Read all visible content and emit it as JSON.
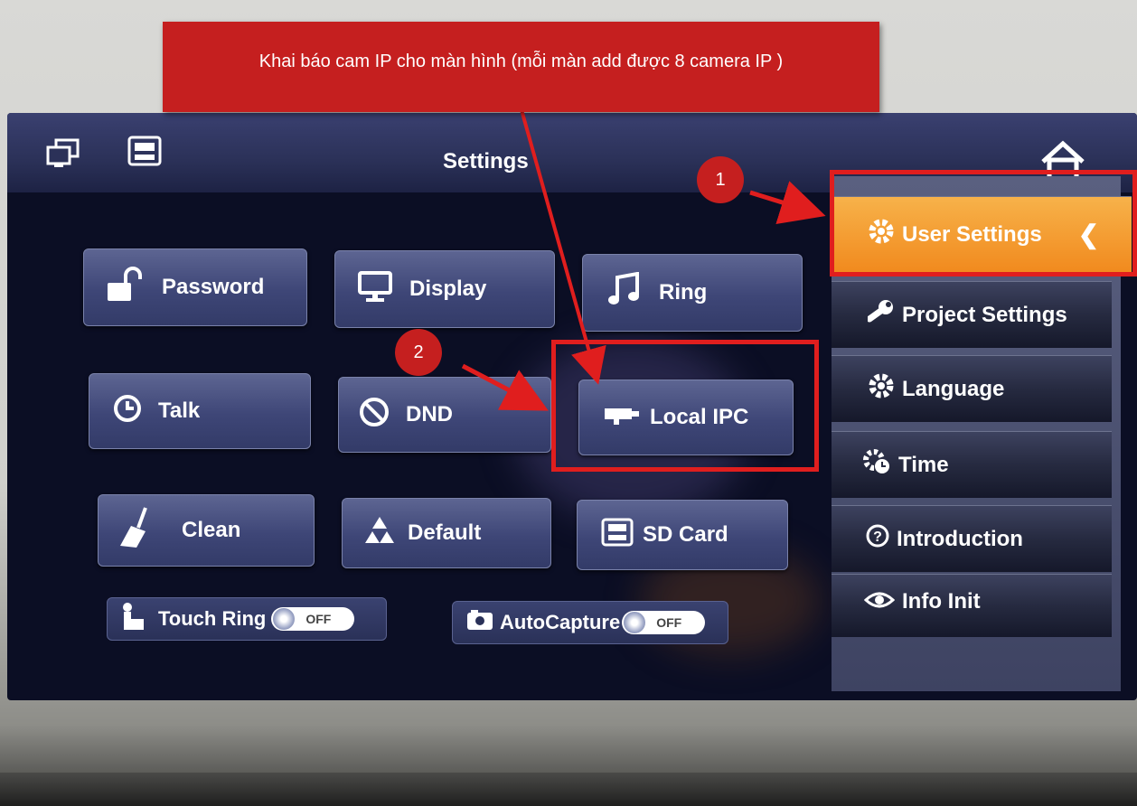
{
  "header": {
    "title": "Settings"
  },
  "buttons": {
    "password": "Password",
    "display": "Display",
    "ring": "Ring",
    "talk": "Talk",
    "dnd": "DND",
    "local_ipc": "Local IPC",
    "clean": "Clean",
    "default": "Default",
    "sd_card": "SD Card"
  },
  "toggles": {
    "touch_ring": {
      "label": "Touch Ring",
      "state": "OFF"
    },
    "auto_capture": {
      "label": "AutoCapture",
      "state": "OFF"
    }
  },
  "sidebar": {
    "items": [
      {
        "label": "User Settings",
        "icon": "gear-icon",
        "active": true
      },
      {
        "label": "Project Settings",
        "icon": "wrench-icon"
      },
      {
        "label": "Language",
        "icon": "gear-icon"
      },
      {
        "label": "Time",
        "icon": "gear-clock-icon"
      },
      {
        "label": "Introduction",
        "icon": "question-icon"
      },
      {
        "label": "Info Init",
        "icon": "eye-icon"
      }
    ]
  },
  "annotations": {
    "callout": "Khai báo cam IP cho màn hình (mỗi màn add được 8 camera IP )",
    "step1": "1",
    "step2": "2"
  },
  "colors": {
    "annotation_red": "#c51f1f",
    "active_orange": "#f39a2b",
    "button_blue": "#3e4677"
  }
}
